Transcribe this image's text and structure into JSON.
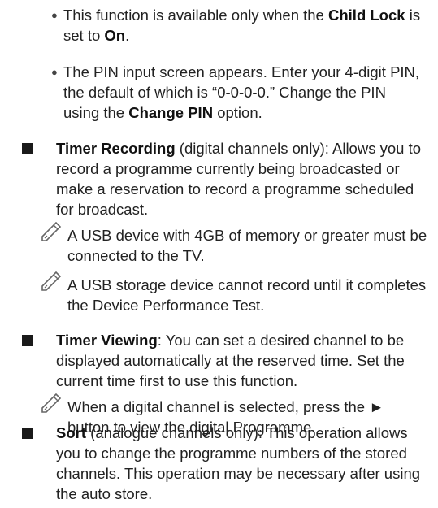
{
  "bullets": [
    {
      "pre": "This function is available only when the ",
      "b1": "Child Lock",
      "mid": " is set to ",
      "b2": "On",
      "post": "."
    },
    {
      "pre": "The PIN input screen appears. Enter your 4-digit PIN, the default of which is “0-0-0-0.” Change the PIN using the ",
      "b1": "Change PIN",
      "post": " option."
    }
  ],
  "timer_recording": {
    "title": "Timer Recording",
    "desc": " (digital channels only): Allows you to record a programme currently being broadcasted or make a reservation to record a programme scheduled for broadcast.",
    "notes": [
      "A USB device with 4GB of memory or greater must be connected to the TV.",
      "A USB storage device cannot record until it completes the Device Performance Test."
    ]
  },
  "timer_viewing": {
    "title": "Timer Viewing",
    "desc": ": You can set a desired channel to be displayed automatically at the reserved time. Set the current time first to use this function.",
    "note_pre": "When a digital channel is selected, press the ",
    "note_arrow": "►",
    "note_post": " button to view the digital Programme."
  },
  "sort": {
    "title": "Sort",
    "desc": " (analogue channels only): This operation allows you to change the programme numbers of the stored channels. This operation may be necessary after using the auto store."
  },
  "icons": {
    "note": "note-pencil-icon",
    "square": "square-bullet-icon",
    "dot": "bullet-dot-icon"
  }
}
